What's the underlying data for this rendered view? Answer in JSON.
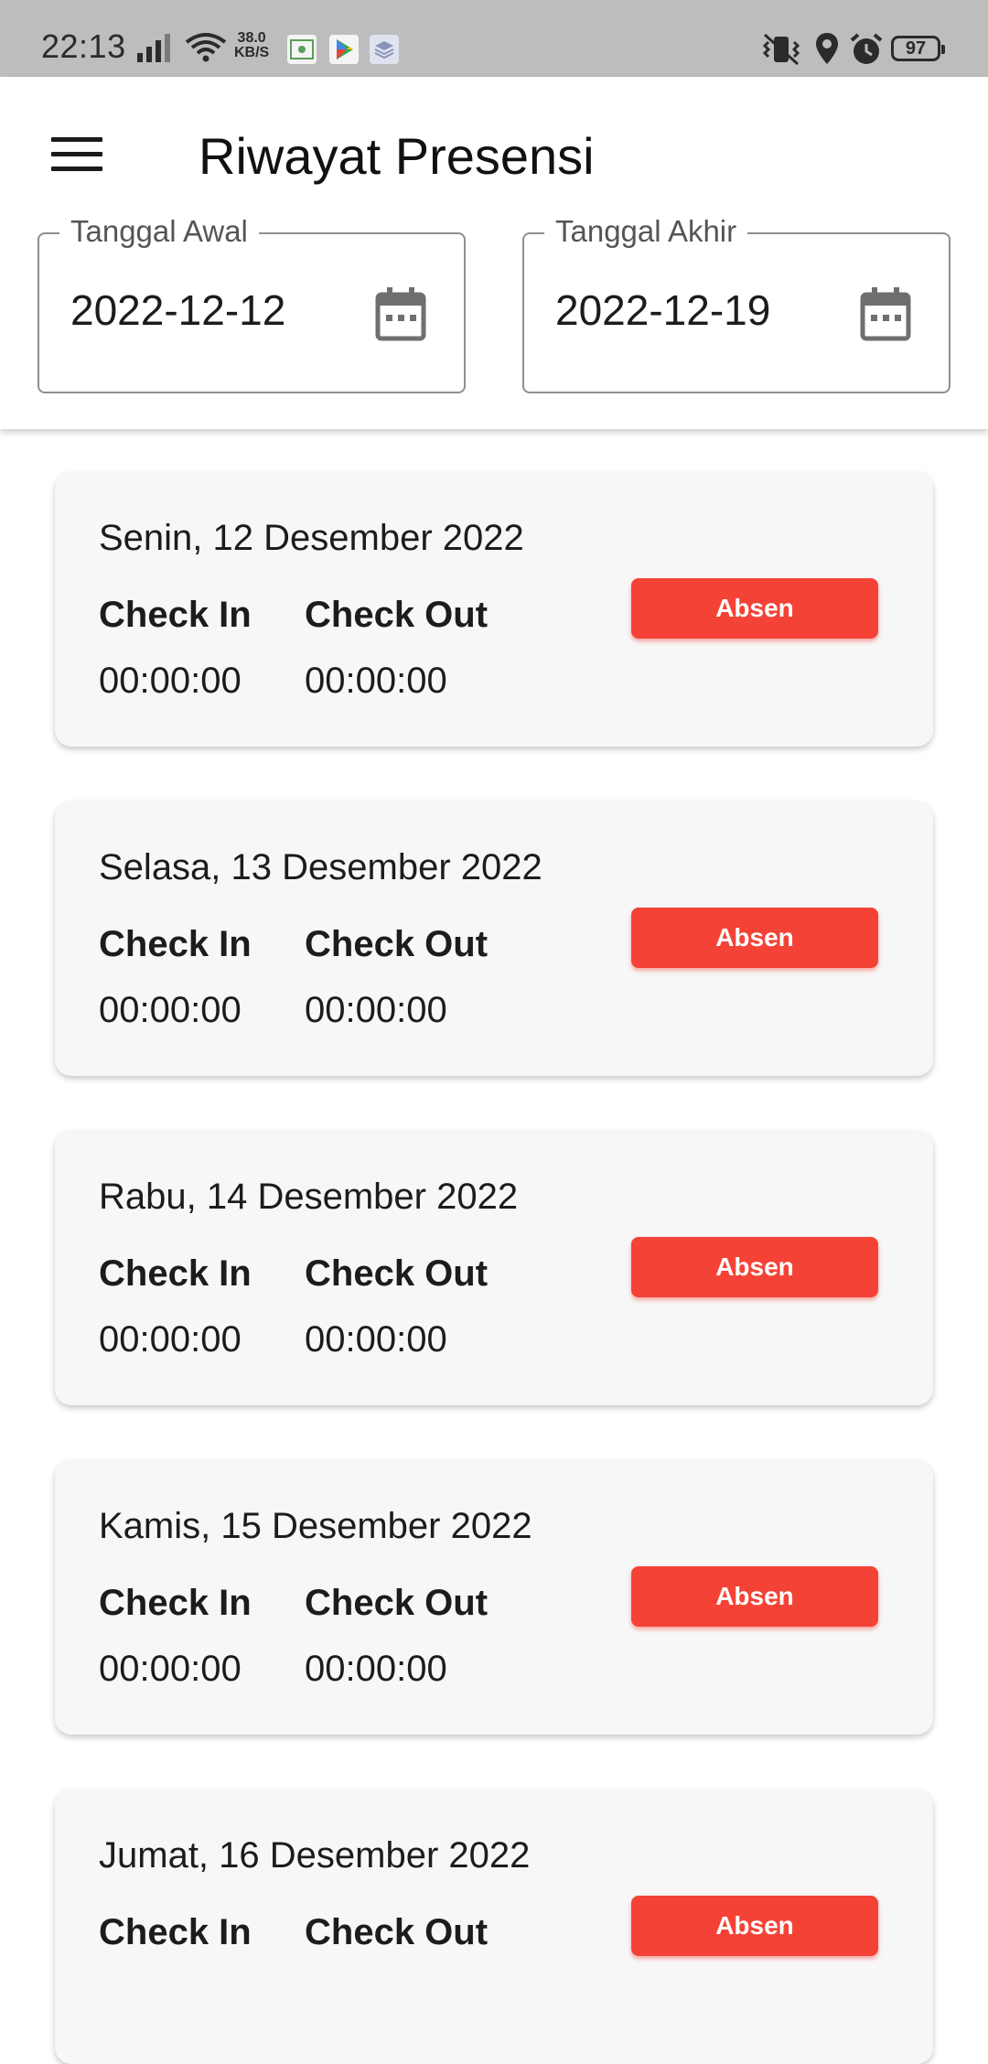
{
  "status_bar": {
    "time": "22:13",
    "speed_value": "38.0",
    "speed_unit": "KB/S",
    "battery": "97",
    "icons": [
      "signal-icon",
      "wifi-icon",
      "app-notification-icon",
      "play-store-icon",
      "layers-icon",
      "vibrate-icon",
      "location-icon",
      "alarm-icon",
      "battery-icon"
    ]
  },
  "header": {
    "title": "Riwayat Presensi",
    "menu_icon": "hamburger-menu-icon"
  },
  "filters": {
    "start": {
      "label": "Tanggal Awal",
      "value": "2022-12-12",
      "icon": "calendar-icon"
    },
    "end": {
      "label": "Tanggal Akhir",
      "value": "2022-12-19",
      "icon": "calendar-icon"
    }
  },
  "colors": {
    "accent": "#f44336",
    "card_bg": "#f7f7f7",
    "status_bar_bg": "#bdbdbd"
  },
  "records": [
    {
      "date": "Senin, 12 Desember 2022",
      "check_in_label": "Check In",
      "check_out_label": "Check Out",
      "check_in": "00:00:00",
      "check_out": "00:00:00",
      "button": "Absen"
    },
    {
      "date": "Selasa, 13 Desember 2022",
      "check_in_label": "Check In",
      "check_out_label": "Check Out",
      "check_in": "00:00:00",
      "check_out": "00:00:00",
      "button": "Absen"
    },
    {
      "date": "Rabu, 14 Desember 2022",
      "check_in_label": "Check In",
      "check_out_label": "Check Out",
      "check_in": "00:00:00",
      "check_out": "00:00:00",
      "button": "Absen"
    },
    {
      "date": "Kamis, 15 Desember 2022",
      "check_in_label": "Check In",
      "check_out_label": "Check Out",
      "check_in": "00:00:00",
      "check_out": "00:00:00",
      "button": "Absen"
    },
    {
      "date": "Jumat, 16 Desember 2022",
      "check_in_label": "Check In",
      "check_out_label": "Check Out",
      "check_in": "",
      "check_out": "",
      "button": "Absen"
    }
  ]
}
